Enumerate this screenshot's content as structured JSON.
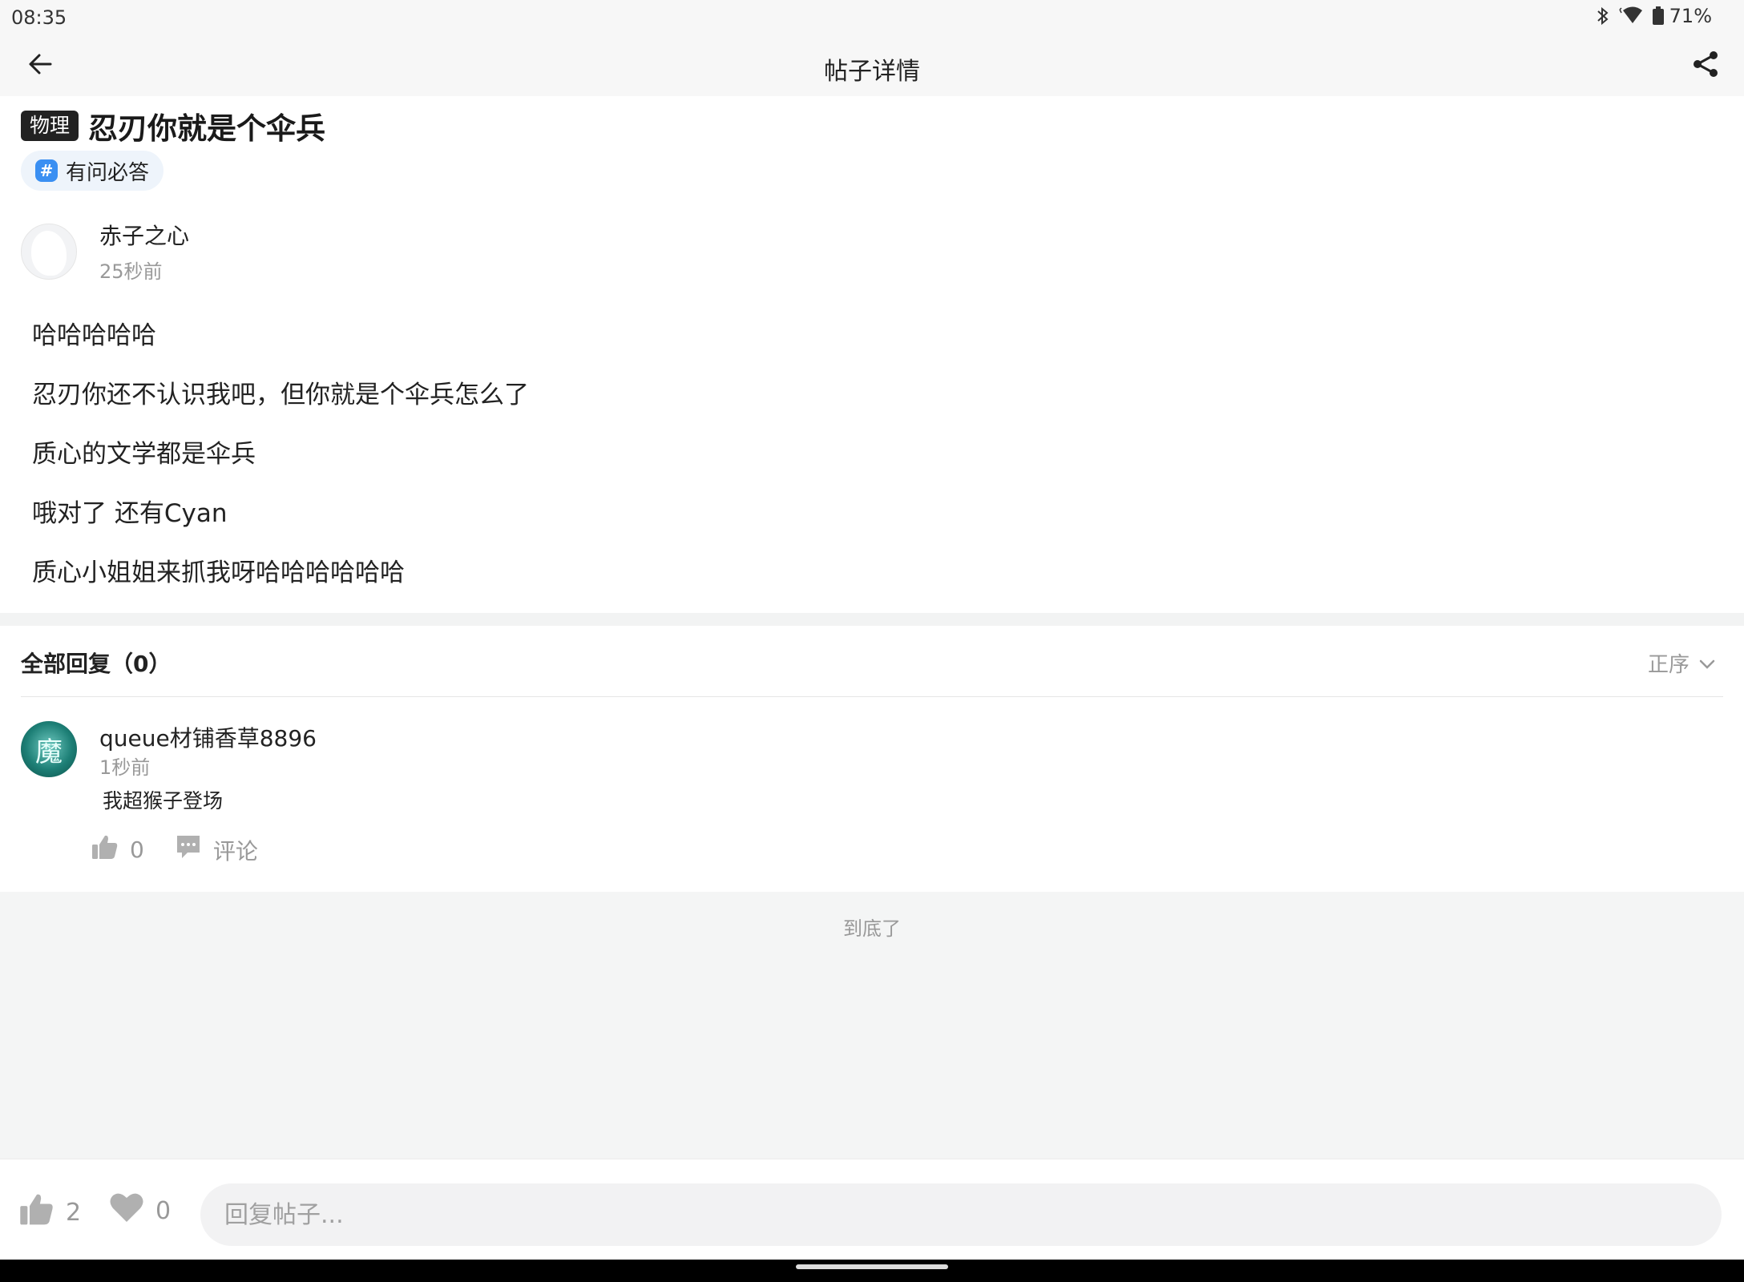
{
  "status_bar": {
    "time": "08:35",
    "battery": "71%"
  },
  "header": {
    "title": "帖子详情"
  },
  "post": {
    "subject_tag": "物理",
    "title": "忍刃你就是个伞兵",
    "topic": "有问必答",
    "author": {
      "name": "赤子之心",
      "time": "25秒前"
    },
    "lines": [
      "哈哈哈哈哈",
      "忍刃你还不认识我吧，但你就是个伞兵怎么了",
      "质心的文学都是伞兵",
      "哦对了 还有Cyan",
      "质心小姐姐来抓我呀哈哈哈哈哈哈"
    ]
  },
  "replies": {
    "header": "全部回复（0）",
    "sort_label": "正序",
    "items": [
      {
        "name": "queue材铺香草8896",
        "time": "1秒前",
        "text": "我超猴子登场",
        "avatar_char": "魔",
        "likes": "0",
        "comment_label": "评论"
      }
    ],
    "end_text": "到底了"
  },
  "bottom_bar": {
    "likes": "2",
    "favorites": "0",
    "reply_placeholder": "回复帖子..."
  },
  "icons": [
    "back-arrow-icon",
    "share-icon",
    "hash-icon",
    "thumb-up-icon",
    "comment-icon",
    "heart-icon",
    "chevron-down-icon",
    "bluetooth-icon",
    "wifi-icon",
    "battery-icon"
  ],
  "colors": {
    "topic_chip_bg": "#eef4fb",
    "hash_badge": "#3a8ff2",
    "icon_gray": "#b0b0b0"
  }
}
